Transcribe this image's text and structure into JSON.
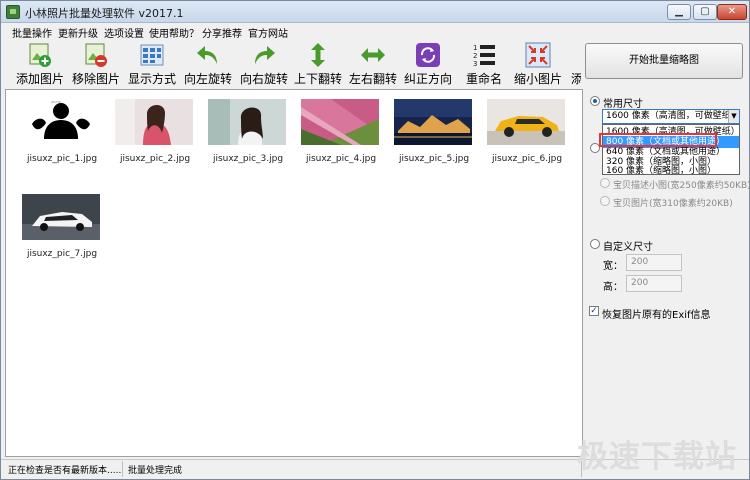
{
  "window": {
    "title": "小林照片批量处理软件 v2017.1",
    "controls": {
      "minimize": "▁",
      "maximize": "▢",
      "close": "✕"
    }
  },
  "menu": [
    "批量操作",
    "更新升级",
    "选项设置",
    "使用帮助？",
    "分享推荐",
    "官方网站"
  ],
  "toolbar": [
    {
      "label": "添加图片",
      "icon": "add-image-icon"
    },
    {
      "label": "移除图片",
      "icon": "remove-image-icon"
    },
    {
      "label": "显示方式",
      "icon": "display-mode-icon"
    },
    {
      "label": "向左旋转",
      "icon": "rotate-left-icon"
    },
    {
      "label": "向右旋转",
      "icon": "rotate-right-icon"
    },
    {
      "label": "上下翻转",
      "icon": "flip-vertical-icon"
    },
    {
      "label": "左右翻转",
      "icon": "flip-horizontal-icon"
    },
    {
      "label": "纠正方向",
      "icon": "correct-orientation-icon"
    },
    {
      "label": "重命名",
      "icon": "rename-icon"
    },
    {
      "label": "缩小图片",
      "icon": "shrink-image-icon"
    },
    {
      "label": "添",
      "icon": ""
    }
  ],
  "start_button": "开始批量缩略图",
  "images": [
    {
      "name": "jisuxz_pic_1.jpg"
    },
    {
      "name": "jisuxz_pic_2.jpg"
    },
    {
      "name": "jisuxz_pic_3.jpg"
    },
    {
      "name": "jisuxz_pic_4.jpg"
    },
    {
      "name": "jisuxz_pic_5.jpg"
    },
    {
      "name": "jisuxz_pic_6.jpg"
    },
    {
      "name": "jisuxz_pic_7.jpg"
    }
  ],
  "settings": {
    "common_size_label": "常用尺寸",
    "size_selected": "1600 像素（高清图，可做壁纸）",
    "size_options": [
      "1600 像素（高清图，可做壁纸）",
      "800 像素（文档或其他用途）",
      "640 像素（文档或其他用途）",
      "320 像素（缩略图，小图）",
      "160 像素（缩略图，小图）"
    ],
    "highlighted_option_index": 1,
    "hidden_radio_stub": "",
    "taobao_desc": "宝贝描述小图(宽250像素约50KB)",
    "taobao_pic": "宝贝图片(宽310像素约20KB)",
    "custom_size_label": "自定义尺寸",
    "width_label": "宽：",
    "width_value": "200",
    "height_label": "高：",
    "height_value": "200",
    "exif_label": "恢复图片原有的Exif信息",
    "exif_checked": true
  },
  "status": {
    "left": "正在检查是否有最新版本.....",
    "right": "批量处理完成"
  },
  "watermark": "极速下载站"
}
